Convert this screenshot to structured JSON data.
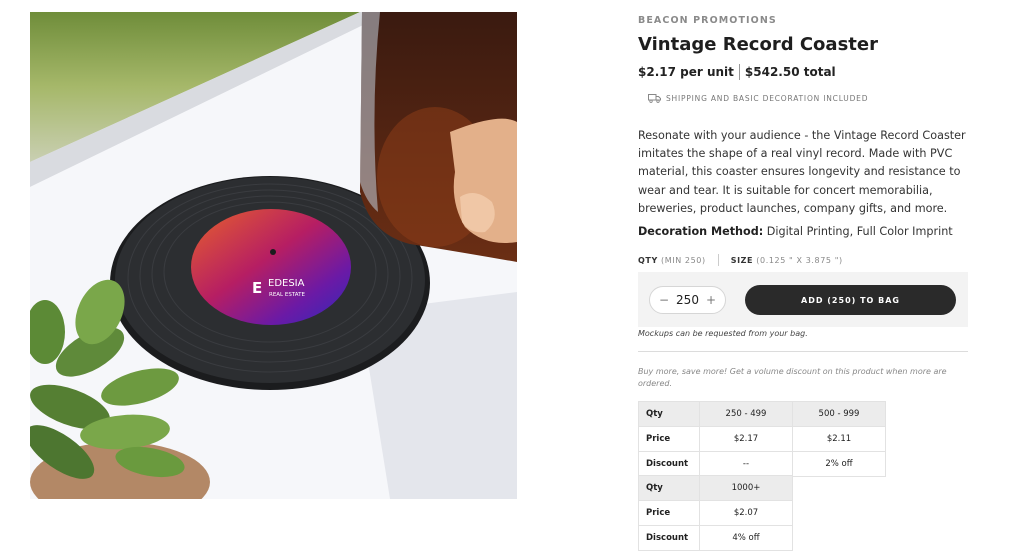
{
  "product": {
    "brand": "BEACON PROMOTIONS",
    "title": "Vintage Record Coaster",
    "unit_price": "$2.17 per unit",
    "total_price": "$542.50 total",
    "shipping_note": "SHIPPING AND BASIC DECORATION INCLUDED",
    "description": "Resonate with your audience - the Vintage Record Coaster imitates the shape of a real vinyl record. Made with PVC material, this coaster ensures longevity and resistance to wear and tear. It is suitable for concert memorabilia, breweries, product launches, company gifts, and more.",
    "decoration_label": "Decoration Method:",
    "decoration_value": "Digital Printing, Full Color Imprint",
    "image_logo_main": "EDESIA",
    "image_logo_sub": "REAL ESTATE"
  },
  "options": {
    "qty_label": "QTY",
    "qty_min": "(MIN 250)",
    "size_label": "SIZE",
    "size_value": "(0.125 \" X 3.875 \")"
  },
  "cart": {
    "minus": "−",
    "plus": "+",
    "quantity": "250",
    "add_button": "ADD (250) TO BAG",
    "mockups_note": "Mockups can be requested from your bag."
  },
  "volume_note": "Buy more, save more! Get a volume discount on this product when more are ordered.",
  "pricing": {
    "row_labels": {
      "qty": "Qty",
      "price": "Price",
      "discount": "Discount"
    },
    "table1": [
      {
        "qty": "250 - 499",
        "price": "$2.17",
        "discount": "--"
      },
      {
        "qty": "500 - 999",
        "price": "$2.11",
        "discount": "2% off"
      }
    ],
    "table2": [
      {
        "qty": "1000+",
        "price": "$2.07",
        "discount": "4% off"
      }
    ]
  },
  "colors": {
    "button_bg": "#2a2a2a",
    "cart_box_bg": "#f3f3f3",
    "table_header_bg": "#ececec"
  }
}
